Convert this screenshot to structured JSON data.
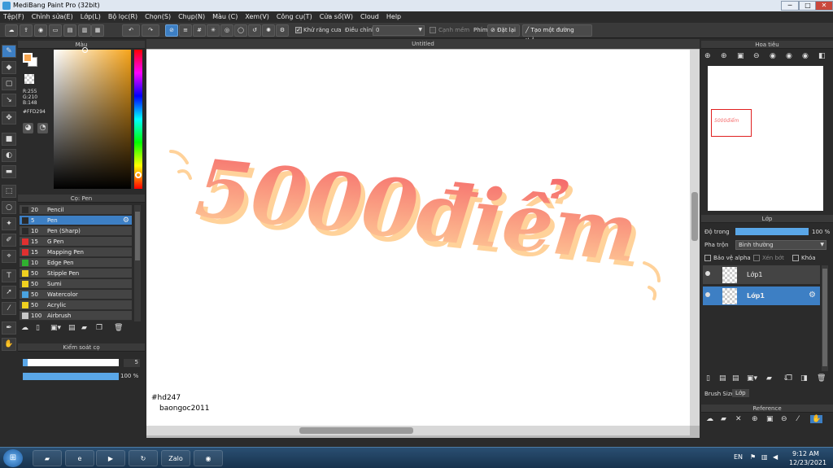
{
  "window": {
    "title": "MediBang Paint Pro (32bit)",
    "min": "─",
    "max": "□",
    "close": "✕"
  },
  "menu": [
    "Tệp(F)",
    "Chỉnh sửa(E)",
    "Lớp(L)",
    "Bộ lọc(R)",
    "Chọn(S)",
    "Chụp(N)",
    "Màu (C)",
    "Xem(V)",
    "Công cụ(T)",
    "Cửa sổ(W)",
    "Cloud",
    "Help"
  ],
  "toolbar": {
    "antialias": "Khử răng cưa",
    "adjust_label": "Điều chỉnh",
    "adjust_value": "0",
    "edge": "Cạnh mềm",
    "key_label": "Phím",
    "reset": "Đặt lại",
    "straight": "Tạo một đường thẳng"
  },
  "canvas": {
    "tab": "Untitled",
    "text": "5000điểm",
    "credit1": "#hd247",
    "credit2": "baongoc2011",
    "text_color_top": "#f56b6b",
    "text_color_bottom": "#ffd29a"
  },
  "color_panel": {
    "title": "Màu",
    "r": "R:255",
    "g": "G:210",
    "b": "B:148",
    "hex": "#FFD294",
    "fg_color": "#f5a550"
  },
  "brush_panel": {
    "title": "Cọ: Pen",
    "items": [
      {
        "size": "20",
        "name": "Pencil",
        "color": "#2a2a2a"
      },
      {
        "size": "5",
        "name": "Pen",
        "color": "#2a2a2a"
      },
      {
        "size": "10",
        "name": "Pen (Sharp)",
        "color": "#2a2a2a"
      },
      {
        "size": "15",
        "name": "G Pen",
        "color": "#e03030"
      },
      {
        "size": "15",
        "name": "Mapping Pen",
        "color": "#e03030"
      },
      {
        "size": "10",
        "name": "Edge Pen",
        "color": "#30b030"
      },
      {
        "size": "50",
        "name": "Stipple Pen",
        "color": "#f0d020"
      },
      {
        "size": "50",
        "name": "Sumi",
        "color": "#f0d020"
      },
      {
        "size": "50",
        "name": "Watercolor",
        "color": "#4aa3e0"
      },
      {
        "size": "50",
        "name": "Acrylic",
        "color": "#f0d020"
      },
      {
        "size": "100",
        "name": "Airbrush",
        "color": "#c8c8c8"
      }
    ]
  },
  "brush_control": {
    "title": "Kiểm soát cọ",
    "size_value": "5",
    "opacity_value": "100 %",
    "size_fraction": 0.05,
    "opacity_fraction": 1.0
  },
  "navigator": {
    "title": "Hoa tiêu"
  },
  "layer_panel": {
    "title": "Lớp",
    "opacity_label": "Độ trong",
    "opacity_value": "100 %",
    "blend_label": "Pha trộn",
    "blend_value": "Bình thường",
    "protect_alpha": "Bảo vệ alpha",
    "clip": "Xén bớt",
    "lock": "Khóa",
    "layers": [
      "Lớp1",
      "Lớp1"
    ]
  },
  "tabs": {
    "brush_size": "Brush Size",
    "layer": "Lớp"
  },
  "reference": {
    "title": "Reference"
  },
  "taskbar": {
    "lang": "EN",
    "time": "9:12 AM",
    "date": "12/23/2021",
    "zalo": "Zalo"
  }
}
